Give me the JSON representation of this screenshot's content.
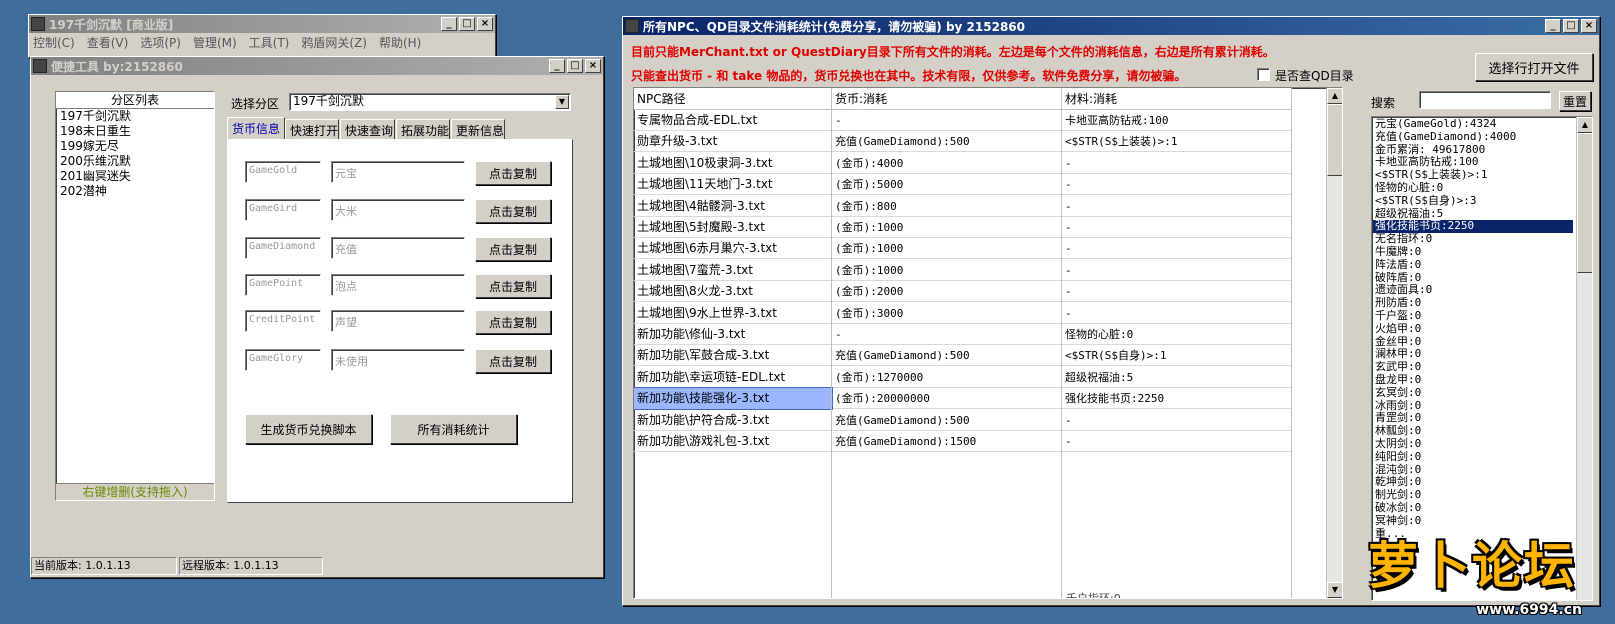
{
  "main_window": {
    "title": "197千剑沉默 [商业版]",
    "menu": [
      "控制(C)",
      "查看(V)",
      "选项(P)",
      "管理(M)",
      "工具(T)",
      "鸦盾网关(Z)",
      "帮助(H)"
    ]
  },
  "tool_window": {
    "title": "便捷工具   by:2152860",
    "partition_list_header": "分区列表",
    "partitions": [
      "197千剑沉默",
      "198末日重生",
      "199嫁无尽",
      "200乐维沉默",
      "201幽冥迷失",
      "202潜神"
    ],
    "partition_footer": "右键增删(支持拖入)",
    "select_label": "选择分区",
    "select_value": "197千剑沉默",
    "tabs": [
      "货币信息",
      "快速打开",
      "快速查询",
      "拓展功能",
      "更新信息"
    ],
    "currencies": [
      {
        "code": "GameGold",
        "name": "元宝",
        "button": "点击复制"
      },
      {
        "code": "GameGird",
        "name": "大米",
        "button": "点击复制"
      },
      {
        "code": "GameDiamond",
        "name": "充值",
        "button": "点击复制"
      },
      {
        "code": "GamePoint",
        "name": "泡点",
        "button": "点击复制"
      },
      {
        "code": "CreditPoint",
        "name": "声望",
        "button": "点击复制"
      },
      {
        "code": "GameGlory",
        "name": "未使用",
        "button": "点击复制"
      }
    ],
    "gen_script_button": "生成货币兑换脚本",
    "all_stats_button": "所有消耗统计",
    "status_current": "当前版本: 1.0.1.13",
    "status_remote": "远程版本: 1.0.1.13"
  },
  "stats_window": {
    "title": "所有NPC、QD目录文件消耗统计(免费分享，请勿被骗)      by 2152860",
    "notice1": "目前只能MerChant.txt or QuestDiary目录下所有文件的消耗。左边是每个文件的消耗信息，右边是所有累计消耗。",
    "notice2": "只能查出货币 - 和 take 物品的，货币兑换也在其中。技术有限，仅供参考。软件免费分享，请勿被骗。",
    "qd_checkbox_label": "是否查QD目录",
    "open_file_button": "选择行打开文件",
    "search_label": "搜索",
    "reset_button": "重置",
    "columns": [
      "NPC路径",
      "货币:消耗",
      "材料:消耗"
    ],
    "rows": [
      [
        "专属物品合成-EDL.txt",
        "-",
        "卡地亚高防钻戒:100"
      ],
      [
        "勋章升级-3.txt",
        "充值(GameDiamond):500",
        "<$STR(S$上装装)>:1"
      ],
      [
        "土城地图\\10极隶洞-3.txt",
        "(金币):4000",
        "-"
      ],
      [
        "土城地图\\11天地门-3.txt",
        "(金币):5000",
        "-"
      ],
      [
        "土城地图\\4骷髅洞-3.txt",
        "(金币):800",
        "-"
      ],
      [
        "土城地图\\5封魔殿-3.txt",
        "(金币):1000",
        "-"
      ],
      [
        "土城地图\\6赤月巢穴-3.txt",
        "(金币):1000",
        "-"
      ],
      [
        "土城地图\\7蛮荒-3.txt",
        "(金币):1000",
        "-"
      ],
      [
        "土城地图\\8火龙-3.txt",
        "(金币):2000",
        "-"
      ],
      [
        "土城地图\\9水上世界-3.txt",
        "(金币):3000",
        "-"
      ],
      [
        "新加功能\\修仙-3.txt",
        "-",
        "怪物的心脏:0"
      ],
      [
        "新加功能\\军鼓合成-3.txt",
        "充值(GameDiamond):500",
        "<$STR(S$自身)>:1"
      ],
      [
        "新加功能\\幸运项链-EDL.txt",
        "(金币):1270000",
        "超级祝福油:5"
      ],
      [
        "新加功能\\技能强化-3.txt",
        "(金币):20000000",
        "强化技能书页:2250"
      ],
      [
        "新加功能\\护符合成-3.txt",
        "充值(GameDiamond):500",
        "-"
      ],
      [
        "新加功能\\游戏礼包-3.txt",
        "充值(GameDiamond):1500",
        "-"
      ]
    ],
    "selected_row": 13,
    "bottom_partial": "千户指环:0",
    "totals": [
      "元宝(GameGold):4324",
      "充值(GameDiamond):4000",
      "金币累消: 49617800",
      "卡地亚高防钻戒:100",
      "<$STR(S$上装装)>:1",
      "怪物的心脏:0",
      "<$STR(S$自身)>:3",
      "超级祝福油:5",
      "强化技能书页:2250",
      "无名指环:0",
      "牛魔牌:0",
      "阵法盾:0",
      "破阵盾:0",
      "遗迹面具:0",
      "刑防盾:0",
      "千户盔:0",
      "火焰甲:0",
      "金丝甲:0",
      "澜林甲:0",
      "玄武甲:0",
      "盘龙甲:0",
      "玄冥剑:0",
      "冰雨剑:0",
      "青罡剑:0",
      "林瓢剑:0",
      "太阴剑:0",
      "纯阳剑:0",
      "混沌剑:0",
      "乾坤剑:0",
      "制光剑:0",
      "破冰剑:0",
      "冥神剑:0",
      "重..."
    ],
    "totals_selected": 8
  },
  "watermark": {
    "brand": "萝卜论坛",
    "url": "www.6994.cn"
  }
}
